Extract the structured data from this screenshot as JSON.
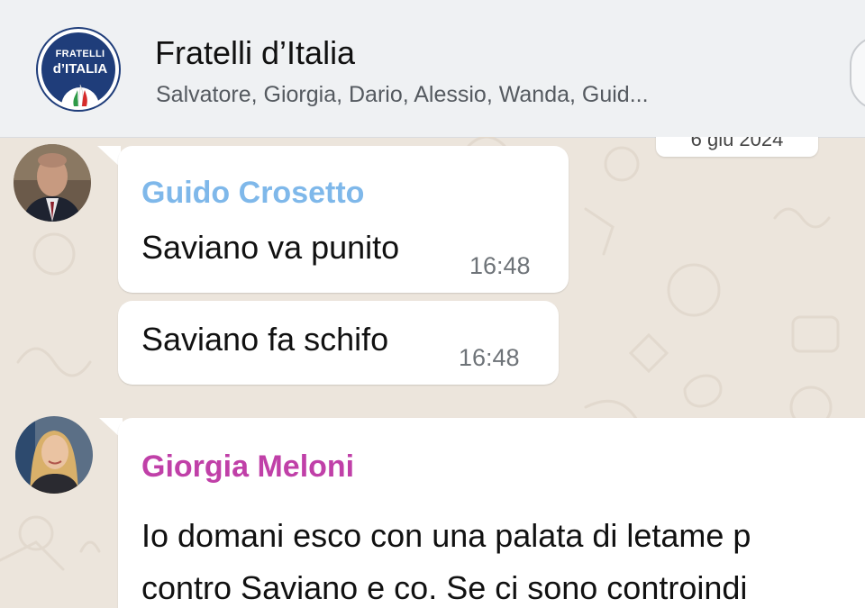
{
  "header": {
    "title": "Fratelli d’Italia",
    "members": "Salvatore, Giorgia, Dario, Alessio, Wanda, Guid...",
    "logo_line1": "FRATELLI",
    "logo_line2": "d’ITALIA"
  },
  "chat": {
    "date_pill": "6 giu 2024",
    "messages": [
      {
        "sender": "Guido Crosetto",
        "sender_color": "#7fb8ea",
        "bubbles": [
          {
            "text": "Saviano va punito",
            "time": "16:48"
          },
          {
            "text": "Saviano fa schifo",
            "time": "16:48"
          }
        ]
      },
      {
        "sender": "Giorgia Meloni",
        "sender_color": "#c040a8",
        "lines": [
          "Io domani esco con una palata di letame p",
          "contro Saviano e co. Se ci sono controindi"
        ]
      }
    ]
  },
  "colors": {
    "header_bg": "#eff1f3",
    "chat_bg": "#ece5dc",
    "bubble_bg": "#ffffff"
  },
  "icons": [
    "group-logo-icon",
    "contact-avatar"
  ]
}
